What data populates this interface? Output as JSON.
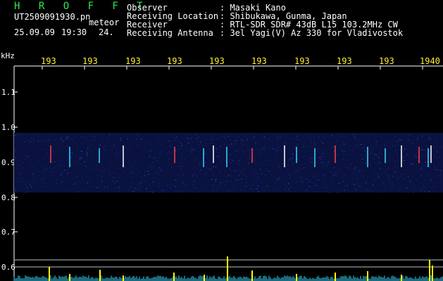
{
  "header": {
    "title": "H R O F F T",
    "file_name": "UT2509091930.pn",
    "meteor_label": "meteor",
    "datetime": "25.09.09 19:30",
    "count": "24."
  },
  "meta": [
    {
      "key": "Observer",
      "value": ": Masaki Kano"
    },
    {
      "key": "Receiving Location",
      "value": ": Shibukawa, Gunma, Japan"
    },
    {
      "key": "Receiver",
      "value": ": RTL-SDR SDR# 43dB L15 103.2MHz CW"
    },
    {
      "key": "Receiving Antenna",
      "value": ": 3el Yagi(V) Az 330 for Vladivostok"
    }
  ],
  "axis": {
    "unit": "kHz",
    "y_labels": [
      "1.1",
      "1.0",
      "0.9",
      "0.8",
      "0.7",
      "0.6"
    ],
    "x_ticks": [
      "193",
      "193",
      "193",
      "193",
      "193",
      "193",
      "193",
      "193",
      "193",
      "1940"
    ]
  },
  "colors": {
    "background": "#000000",
    "title": "#2ee84d",
    "ticks": "#ffee33",
    "spectrum_band": "#1a2a8c",
    "amplitude": "#33d9ff",
    "meteor_peak": "#ffff00"
  }
}
